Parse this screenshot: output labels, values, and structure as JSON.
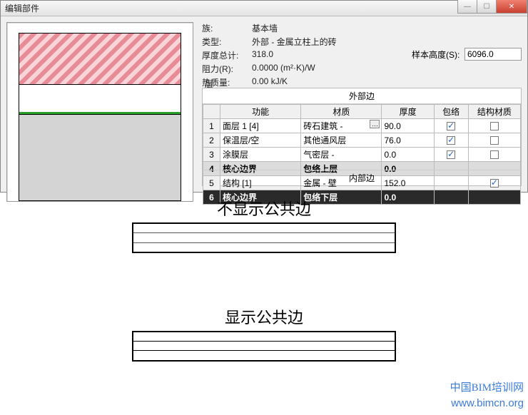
{
  "window": {
    "title": "编辑部件"
  },
  "info": {
    "family_label": "族:",
    "family_value": "基本墙",
    "type_label": "类型:",
    "type_value": "外部 - 金属立柱上的砖",
    "thickness_label": "厚度总计:",
    "thickness_value": "318.0",
    "resistance_label": "阻力(R):",
    "resistance_value": "0.0000 (m²·K)/W",
    "thermal_label": "热质量:",
    "thermal_value": "0.00 kJ/K",
    "sample_height_label": "样本高度(S):",
    "sample_height_value": "6096.0"
  },
  "layers": {
    "section_label": "层",
    "ext_label": "外部边",
    "int_label": "内部边",
    "headers": [
      "",
      "功能",
      "材质",
      "厚度",
      "包络",
      "结构材质"
    ],
    "rows": [
      {
        "n": "1",
        "func": "面层 1 [4]",
        "mat": "砖石建筑 -",
        "thick": "90.0",
        "wrap": true,
        "struct": false,
        "core": false,
        "sel": false,
        "dots": true
      },
      {
        "n": "2",
        "func": "保温层/空",
        "mat": "其他通风层",
        "thick": "76.0",
        "wrap": true,
        "struct": false,
        "core": false,
        "sel": false,
        "dots": false
      },
      {
        "n": "3",
        "func": "涂膜层",
        "mat": "气密层 -",
        "thick": "0.0",
        "wrap": true,
        "struct": false,
        "core": false,
        "sel": false,
        "dots": false
      },
      {
        "n": "4",
        "func": "核心边界",
        "mat": "包络上层",
        "thick": "0.0",
        "wrap": null,
        "struct": null,
        "core": true,
        "sel": false,
        "dots": false
      },
      {
        "n": "5",
        "func": "结构 [1]",
        "mat": "金属 - 壁",
        "thick": "152.0",
        "wrap": null,
        "struct": true,
        "core": false,
        "sel": false,
        "dots": false
      },
      {
        "n": "6",
        "func": "核心边界",
        "mat": "包络下层",
        "thick": "0.0",
        "wrap": null,
        "struct": null,
        "core": true,
        "sel": true,
        "dots": false
      }
    ]
  },
  "captions": {
    "no_edge": "不显示公共边",
    "edge": "显示公共边"
  },
  "watermark": {
    "line1": "中国BIM培训网",
    "line2": "www.bimcn.org"
  }
}
